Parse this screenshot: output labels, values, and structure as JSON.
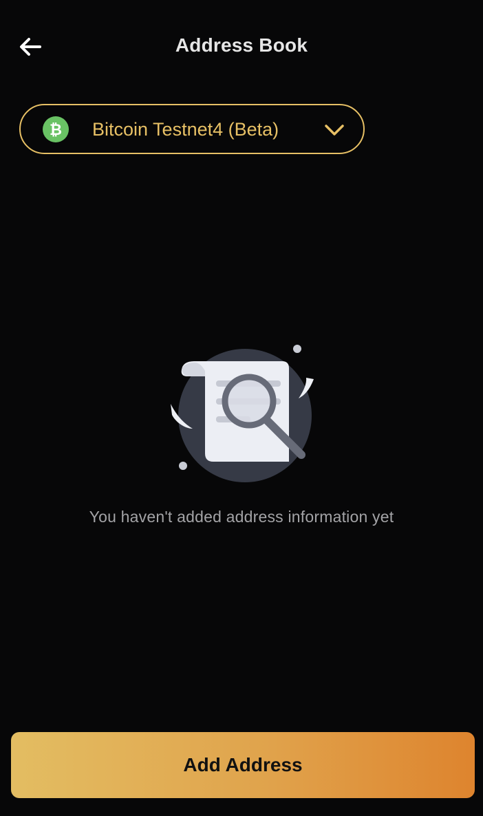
{
  "header": {
    "title": "Address Book",
    "back_icon": "arrow-left-icon"
  },
  "network_selector": {
    "label": "Bitcoin Testnet4 (Beta)",
    "icon": "bitcoin-icon",
    "icon_color": "#69c264",
    "accent_color": "#e7c065",
    "chevron_icon": "chevron-down-icon"
  },
  "empty_state": {
    "illustration": "empty-search-document-icon",
    "message": "You haven't added address information yet"
  },
  "actions": {
    "add_address_label": "Add Address"
  },
  "colors": {
    "background": "#070708",
    "accent": "#e7c065",
    "button_gradient_start": "#e3bd62",
    "button_gradient_end": "#de842e"
  }
}
